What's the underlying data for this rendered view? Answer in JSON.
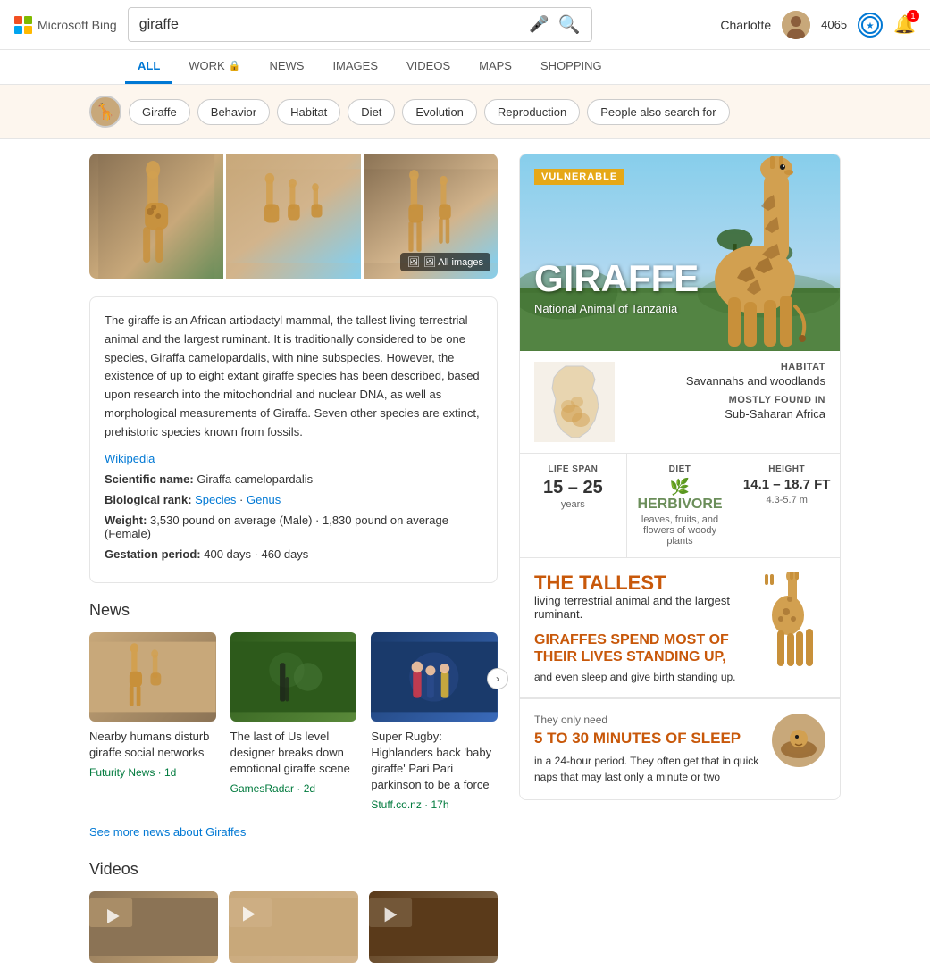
{
  "header": {
    "logo_text": "Microsoft Bing",
    "search_query": "giraffe",
    "mic_placeholder": "🎤",
    "search_placeholder": "🔍",
    "user_name": "Charlotte",
    "points": "4065",
    "notif_count": "1"
  },
  "nav": {
    "tabs": [
      {
        "label": "ALL",
        "active": true
      },
      {
        "label": "WORK",
        "lock": true,
        "active": false
      },
      {
        "label": "NEWS",
        "active": false
      },
      {
        "label": "IMAGES",
        "active": false
      },
      {
        "label": "VIDEOS",
        "active": false
      },
      {
        "label": "MAPS",
        "active": false
      },
      {
        "label": "SHOPPING",
        "active": false
      }
    ]
  },
  "categories": {
    "icon": "🦒",
    "pills": [
      "Giraffe",
      "Behavior",
      "Habitat",
      "Diet",
      "Evolution",
      "Reproduction",
      "People also search for"
    ]
  },
  "gallery": {
    "all_images_label": "🖼 All images"
  },
  "description": {
    "text": "The giraffe is an African artiodactyl mammal, the tallest living terrestrial animal and the largest ruminant. It is traditionally considered to be one species, Giraffa camelopardalis, with nine subspecies. However, the existence of up to eight extant giraffe species has been described, based upon research into the mitochondrial and nuclear DNA, as well as morphological measurements of Giraffa. Seven other species are extinct, prehistoric species known from fossils.",
    "wiki_label": "Wikipedia",
    "facts": [
      {
        "label": "Scientific name:",
        "value": "Giraffa camelopardalis",
        "link": false
      },
      {
        "label": "Biological rank:",
        "species": "Species",
        "genus": "Genus"
      },
      {
        "label": "Weight:",
        "value": "3,530 pound on average (Male) · 1,830 pound on average (Female)",
        "link": false
      },
      {
        "label": "Gestation period:",
        "value": "400 days · 460 days",
        "link": false
      }
    ]
  },
  "news": {
    "section_title": "News",
    "items": [
      {
        "title": "Nearby humans disturb giraffe social networks",
        "source": "Futurity News",
        "time": "1d",
        "bg": "news-img-bg1"
      },
      {
        "title": "The last of Us level designer breaks down emotional giraffe scene",
        "source": "GamesRadar",
        "time": "2d",
        "bg": "news-img-bg2"
      },
      {
        "title": "Super Rugby: Highlanders back 'baby giraffe' Pari Pari parkinson to be a force",
        "source": "Stuff.co.nz",
        "time": "17h",
        "bg": "news-img-bg3"
      }
    ],
    "see_more_label": "See more news about Giraffes"
  },
  "videos": {
    "section_title": "Videos"
  },
  "knowledge_card": {
    "vulnerable_badge": "VULNERABLE",
    "title": "GIRAFFE",
    "subtitle": "National Animal of Tanzania",
    "habitat_label": "HABITAT",
    "habitat_value": "Savannahs and woodlands",
    "found_label": "MOSTLY FOUND IN",
    "found_value": "Sub-Saharan Africa",
    "stats": [
      {
        "label": "LIFE SPAN",
        "value": "15 – 25",
        "sub": "years"
      },
      {
        "label": "DIET",
        "value": "HERBIVORE",
        "sub": "leaves, fruits, and flowers of woody plants",
        "is_herbivore": true
      },
      {
        "label": "HEIGHT",
        "value": "14.1 – 18.7 FT",
        "sub": "4.3-5.7 m"
      }
    ],
    "tallest_label": "THE TALLEST",
    "tallest_desc": "living terrestrial animal and the largest ruminant.",
    "stands_up_headline": "GIRAFFES SPEND MOST OF THEIR LIVES STANDING UP,",
    "stands_up_desc": "and even sleep and give birth standing up.",
    "sleep_label": "They only need",
    "sleep_mins": "5 TO 30 MINUTES OF SLEEP",
    "sleep_desc": "in a 24-hour period. They often get that in quick naps that may last only a minute or two"
  }
}
